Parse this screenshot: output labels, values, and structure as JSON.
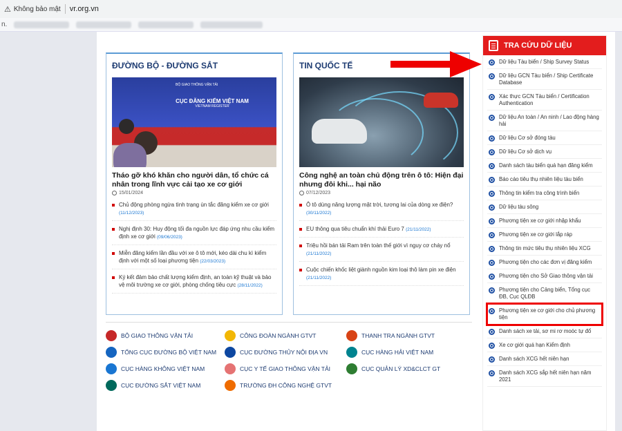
{
  "browser": {
    "insecure_label": "Không bảo mật",
    "url": "vr.org.vn",
    "bookmarks_label": "n."
  },
  "left_column": {
    "title": "ĐƯỜNG BỘ - ĐƯỜNG SẮT",
    "image_banner": "CỤC ĐĂNG KIỂM VIỆT NAM",
    "image_banner_sub": "VIETNAM REGISTER",
    "image_top": "BỘ GIAO THÔNG VẬN TẢI",
    "headline": "Tháo gỡ khó khăn cho người dân, tổ chức cá nhân trong lĩnh vực cải tạo xe cơ giới",
    "date": "15/01/2024",
    "items": [
      {
        "text": "Chủ động phòng ngừa tình trạng ùn tắc đăng kiểm xe cơ giới",
        "date": "(11/12/2023)"
      },
      {
        "text": "Nghị định 30: Huy động tối đa nguồn lực đáp ứng nhu cầu kiểm định xe cơ giới",
        "date": "(09/06/2023)"
      },
      {
        "text": "Miễn đăng kiểm lần đầu với xe ô tô mới, kéo dài chu kì kiểm định với một số loại phương tiện",
        "date": "(22/03/2023)"
      },
      {
        "text": "Ký kết đảm bảo chất lượng kiểm định, an toàn kỹ thuật và bảo vệ môi trường xe cơ giới, phòng chống tiêu cực",
        "date": "(28/11/2022)"
      }
    ]
  },
  "right_column": {
    "title": "TIN QUỐC TẾ",
    "headline": "Công nghệ an toàn chủ động trên ô tô: Hiện đại nhưng đôi khi... hại não",
    "date": "07/12/2023",
    "items": [
      {
        "text": "Ô tô dùng năng lượng mặt trời, tương lai của dòng xe điện?",
        "date": "(30/11/2022)"
      },
      {
        "text": "EU thông qua tiêu chuẩn khí thải Euro 7",
        "date": "(21/11/2022)"
      },
      {
        "text": "Triệu hồi bán tải Ram trên toàn thế giới vì nguy cơ cháy nổ",
        "date": "(21/11/2022)"
      },
      {
        "text": "Cuộc chiến khốc liệt giành nguồn kim loại thô làm pin xe điện",
        "date": "(21/11/2022)"
      }
    ]
  },
  "agencies": [
    {
      "label": "BỘ GIAO THÔNG VẬN TẢI",
      "color": "#c62828"
    },
    {
      "label": "CÔNG ĐOÀN NGÀNH GTVT",
      "color": "#f2b705"
    },
    {
      "label": "THANH TRA NGÀNH GTVT",
      "color": "#d84315"
    },
    {
      "label": "TỔNG CỤC ĐƯỜNG BỘ VIỆT NAM",
      "color": "#1565c0"
    },
    {
      "label": "CỤC ĐƯỜNG THỦY NỘI ĐỊA VN",
      "color": "#0d47a1"
    },
    {
      "label": "CỤC HÀNG HẢI VIỆT NAM",
      "color": "#00838f"
    },
    {
      "label": "CỤC HÀNG KHÔNG VIỆT NAM",
      "color": "#1976d2"
    },
    {
      "label": "CỤC Y TẾ GIAO THÔNG VẬN TẢI",
      "color": "#e57373"
    },
    {
      "label": "CỤC QUẢN LÝ XD&CLCT GT",
      "color": "#2e7d32"
    },
    {
      "label": "CỤC ĐƯỜNG SẮT VIỆT NAM",
      "color": "#00695c"
    },
    {
      "label": "TRƯỜNG ĐH CÔNG NGHỆ GTVT",
      "color": "#ef6c00"
    }
  ],
  "sidebar": {
    "title": "TRA CỨU DỮ LIỆU",
    "items": [
      "Dữ liệu Tàu biển / Ship Survey Status",
      "Dữ liệu GCN Tàu biển / Ship Certificate Database",
      "Xác thực GCN Tàu biển / Certification Authentication",
      "Dữ liệu An toàn / An ninh / Lao động hàng hải",
      "Dữ liệu Cơ sở đóng tàu",
      "Dữ liệu Cơ sở dịch vụ",
      "Danh sách tàu biển quá hạn đăng kiểm",
      "Báo cáo tiêu thụ nhiên liệu tàu biển",
      "Thông tin kiểm tra công trình biển",
      "Dữ liệu tàu sông",
      "Phương tiện xe cơ giới nhập khẩu",
      "Phương tiện xe cơ giới lắp ráp",
      "Thông tin mức tiêu thụ nhiên liệu XCG",
      "Phương tiện cho các đơn vị đăng kiểm",
      "Phương tiện cho Sở Giao thông vận tải",
      "Phương tiện cho Cảng biển, Tổng cục ĐB, Cục QLĐB",
      "Phương tiện xe cơ giới cho chủ phương tiện",
      "Danh sách xe tải, sơ mi rơ moóc tự đổ",
      "Xe cơ giới quá hạn Kiểm định",
      "Danh sách XCG hết niên hạn",
      "Danh sách XCG sắp hết niên hạn năm 2021"
    ],
    "highlight_index": 16
  }
}
